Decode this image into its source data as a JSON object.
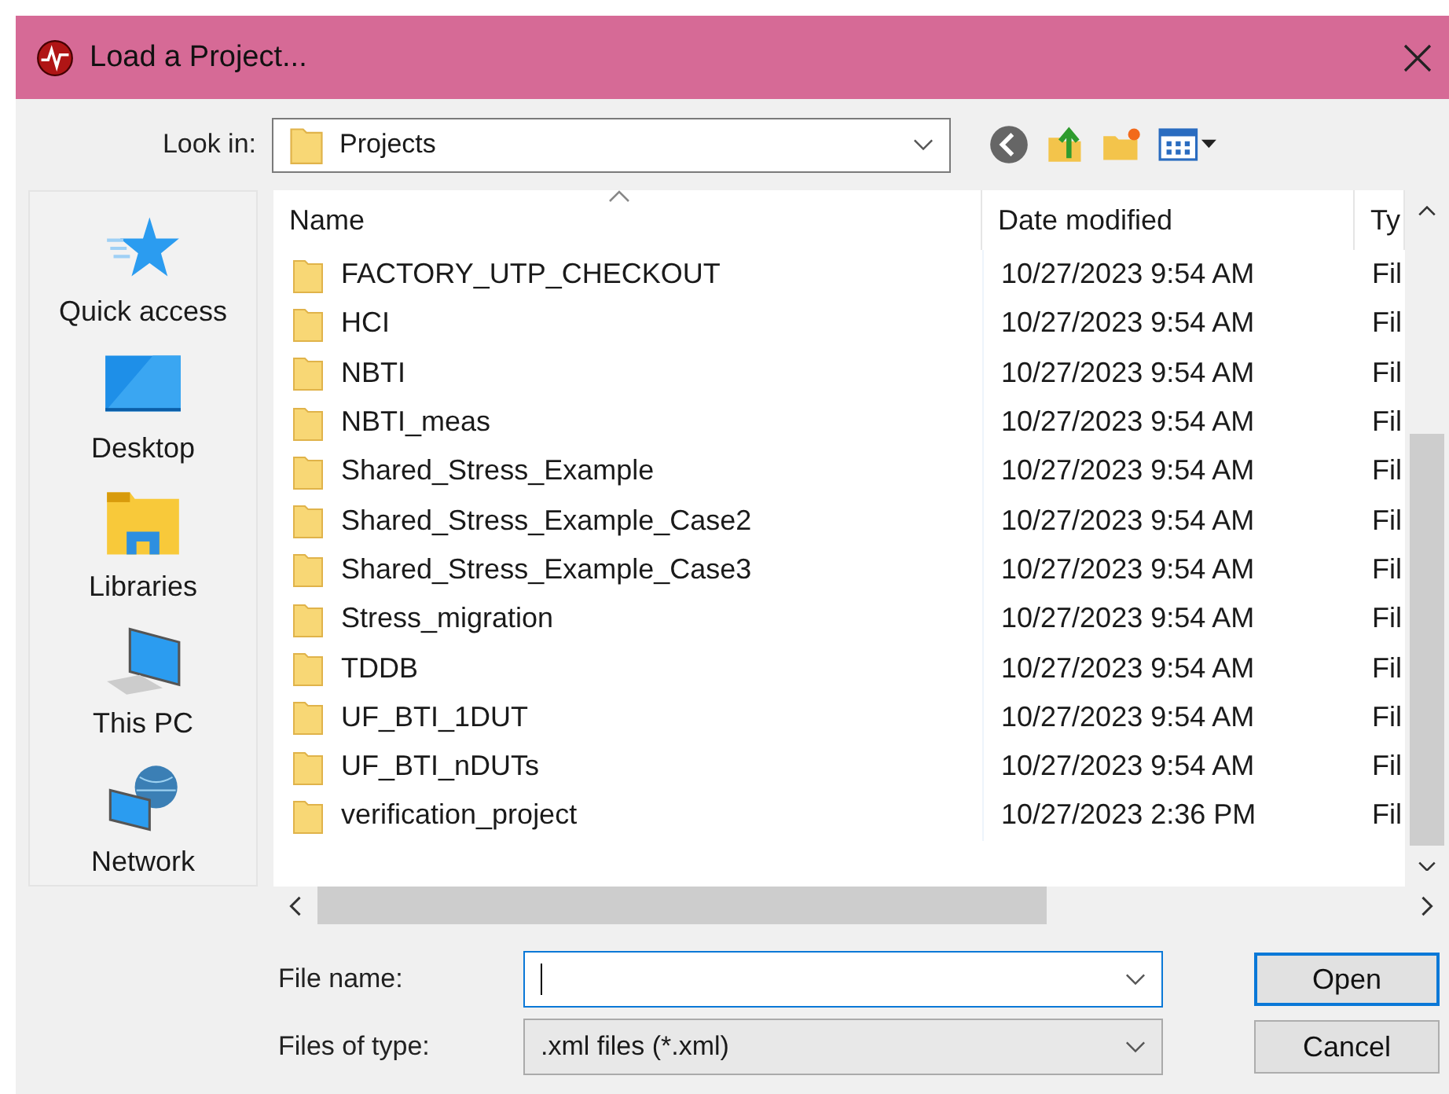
{
  "window": {
    "title": "Load a Project..."
  },
  "look_in": {
    "label": "Look in:",
    "value": "Projects"
  },
  "places": [
    {
      "kind": "quick_access",
      "label": "Quick access"
    },
    {
      "kind": "desktop",
      "label": "Desktop"
    },
    {
      "kind": "libraries",
      "label": "Libraries"
    },
    {
      "kind": "this_pc",
      "label": "This PC"
    },
    {
      "kind": "network",
      "label": "Network"
    }
  ],
  "columns": [
    "Name",
    "Date modified",
    "Ty"
  ],
  "rows": [
    {
      "name": "FACTORY_UTP_CHECKOUT",
      "date": "10/27/2023 9:54 AM",
      "type": "Fil"
    },
    {
      "name": "HCI",
      "date": "10/27/2023 9:54 AM",
      "type": "Fil"
    },
    {
      "name": "NBTI",
      "date": "10/27/2023 9:54 AM",
      "type": "Fil"
    },
    {
      "name": "NBTI_meas",
      "date": "10/27/2023 9:54 AM",
      "type": "Fil"
    },
    {
      "name": "Shared_Stress_Example",
      "date": "10/27/2023 9:54 AM",
      "type": "Fil"
    },
    {
      "name": "Shared_Stress_Example_Case2",
      "date": "10/27/2023 9:54 AM",
      "type": "Fil"
    },
    {
      "name": "Shared_Stress_Example_Case3",
      "date": "10/27/2023 9:54 AM",
      "type": "Fil"
    },
    {
      "name": "Stress_migration",
      "date": "10/27/2023 9:54 AM",
      "type": "Fil"
    },
    {
      "name": "TDDB",
      "date": "10/27/2023 9:54 AM",
      "type": "Fil"
    },
    {
      "name": "UF_BTI_1DUT",
      "date": "10/27/2023 9:54 AM",
      "type": "Fil"
    },
    {
      "name": "UF_BTI_nDUTs",
      "date": "10/27/2023 9:54 AM",
      "type": "Fil"
    },
    {
      "name": "verification_project",
      "date": "10/27/2023 2:36 PM",
      "type": "Fil"
    }
  ],
  "file_name": {
    "label": "File name:",
    "focused": true
  },
  "files_of_type": {
    "label": "Files of type:",
    "value": ".xml files (*.xml)"
  },
  "buttons": [
    {
      "label": "Open",
      "default": true
    },
    {
      "label": "Cancel",
      "default": false
    }
  ]
}
